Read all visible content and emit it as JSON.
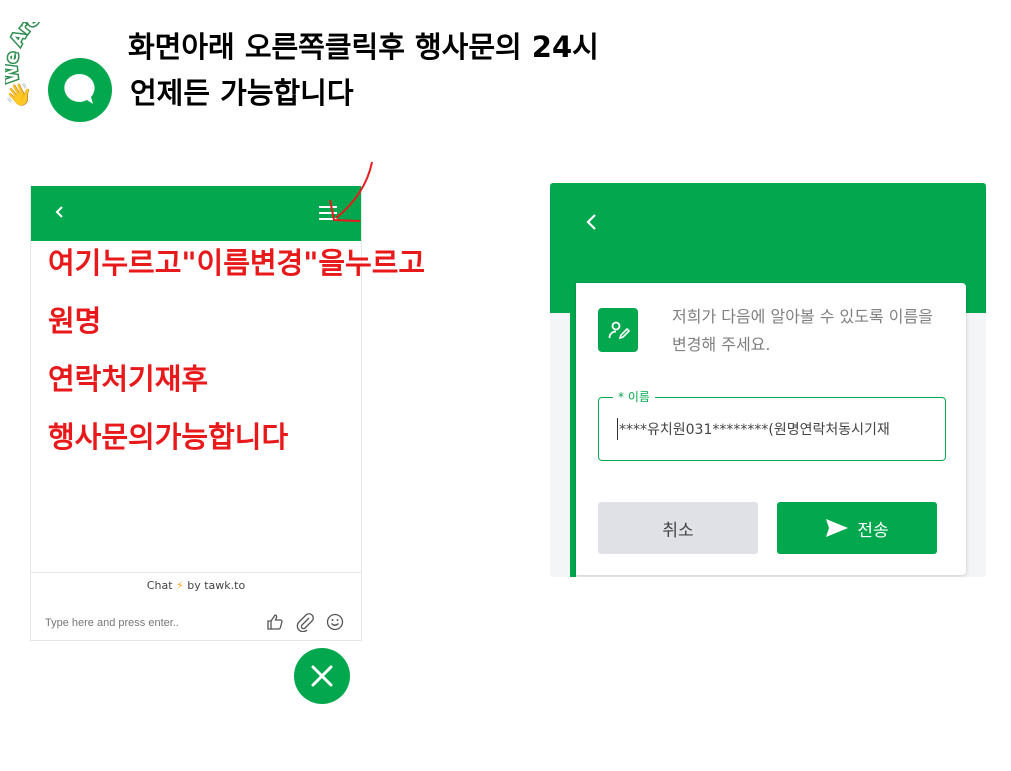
{
  "colors": {
    "brand_green": "#03a84e",
    "annotation_red": "#e8191b",
    "cancel_gray": "#dfe1e6"
  },
  "header": {
    "logo_text": "We Are Here!",
    "headline_line1": "화면아래 오른쪽클릭후 행사문의 24시",
    "headline_line2": "언제든 가능합니다"
  },
  "left_widget": {
    "back_icon": "chevron-left-icon",
    "menu_icon": "hamburger-menu-icon",
    "instructions": [
      "여기누르고\"이름변경\"을누르고",
      "원명",
      "연락처기재후",
      "행사문의가능합니다"
    ],
    "powered_prefix": "Chat",
    "powered_suffix": "by tawk.to",
    "input_placeholder": "Type here and press enter..",
    "input_icons": [
      "thumbs-up-icon",
      "paperclip-icon",
      "smiley-icon"
    ],
    "close_icon": "close-icon"
  },
  "right_widget": {
    "back_icon": "chevron-left-icon",
    "message": "저희가 다음에 알아볼 수 있도록 이름을 변경해 주세요.",
    "field_label": "* 이름",
    "field_value": "****유치원031********(원명연락처동시기재",
    "cancel_label": "취소",
    "send_label": "전송",
    "send_icon": "send-arrow-icon"
  }
}
